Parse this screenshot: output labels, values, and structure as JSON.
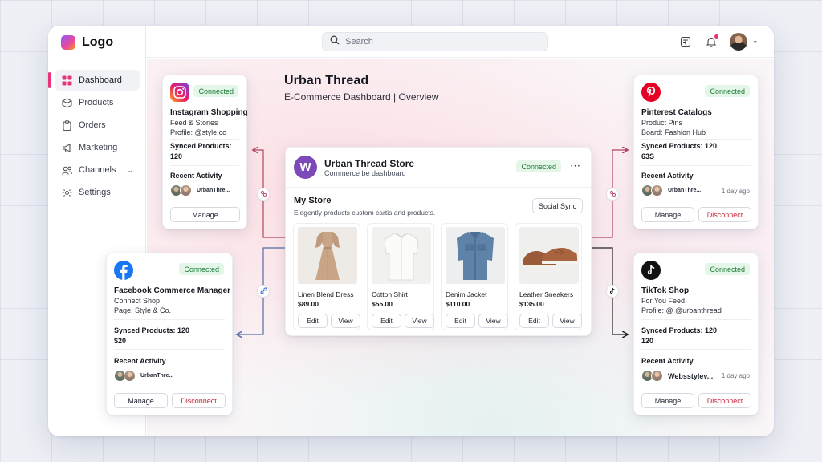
{
  "app": {
    "logo_text": "Logo",
    "search_placeholder": "Search",
    "accent_color": "#e6337a"
  },
  "sidebar": {
    "items": [
      {
        "label": "Dashboard",
        "icon": "grid-icon",
        "active": true
      },
      {
        "label": "Products",
        "icon": "box-icon"
      },
      {
        "label": "Orders",
        "icon": "clipboard-icon"
      },
      {
        "label": "Marketing",
        "icon": "megaphone-icon"
      },
      {
        "label": "Channels",
        "icon": "users-icon",
        "expandable": true
      },
      {
        "label": "Settings",
        "icon": "gear-icon"
      }
    ]
  },
  "header": {
    "title": "Urban Thread",
    "subtitle": "E-Commerce Dashboard | Overview"
  },
  "store": {
    "logo_letter": "W",
    "name": "Urban Thread Store",
    "sub": "Commerce be dashboard",
    "status": "Connected",
    "section_title": "My Store",
    "section_sub": "Elegently products custom cartis and products.",
    "social_sync": "Social Sync",
    "edit_label": "Edit",
    "view_label": "View",
    "products": [
      {
        "name": "Linen Blend Dress",
        "price": "$89.00",
        "image": "dress"
      },
      {
        "name": "Cotton Shirt",
        "price": "$55.00",
        "image": "shirt"
      },
      {
        "name": "Denim Jacket",
        "price": "$110.00",
        "image": "jacket"
      },
      {
        "name": "Leather Sneakers",
        "price": "$135.00",
        "image": "sneakers"
      }
    ]
  },
  "channels": {
    "instagram": {
      "status": "Connected",
      "title": "Instagram Shopping",
      "line1": "Feed & Stories",
      "line2": "Profile: @style.co",
      "synced_label": "Synced Products:",
      "synced_value": "120",
      "recent_label": "Recent Activity",
      "activity_user": "UrbanThre...",
      "manage": "Manage"
    },
    "pinterest": {
      "status": "Connected",
      "title": "Pinterest Catalogs",
      "line1": "Product Pins",
      "line2": "Board: Fashion Hub",
      "synced_label": "Synced Products: 120",
      "synced_value": "63S",
      "recent_label": "Recent Activity",
      "activity_user": "UrbanThre...",
      "activity_time": "1 day ago",
      "manage": "Manage",
      "disconnect": "Disconnect"
    },
    "facebook": {
      "status": "Connected",
      "title": "Facebook Commerce Manager",
      "line1": "Connect Shop",
      "line2": "Page: Style & Co.",
      "synced_label": "Synced Products: 120",
      "synced_value": "$20",
      "recent_label": "Recent Activity",
      "activity_user": "UrbanThre...",
      "manage": "Manage",
      "disconnect": "Disconnect"
    },
    "tiktok": {
      "status": "Connected",
      "title": "TikTok Shop",
      "line1": "For You Feed",
      "line2": "Profile: @ @urbanthread",
      "synced_label": "Synced Products: 120",
      "synced_value": "120",
      "recent_label": "Recent Activity",
      "activity_user": "Websstylev...",
      "activity_time": "1 day ago",
      "manage": "Manage",
      "disconnect": "Disconnect"
    }
  }
}
